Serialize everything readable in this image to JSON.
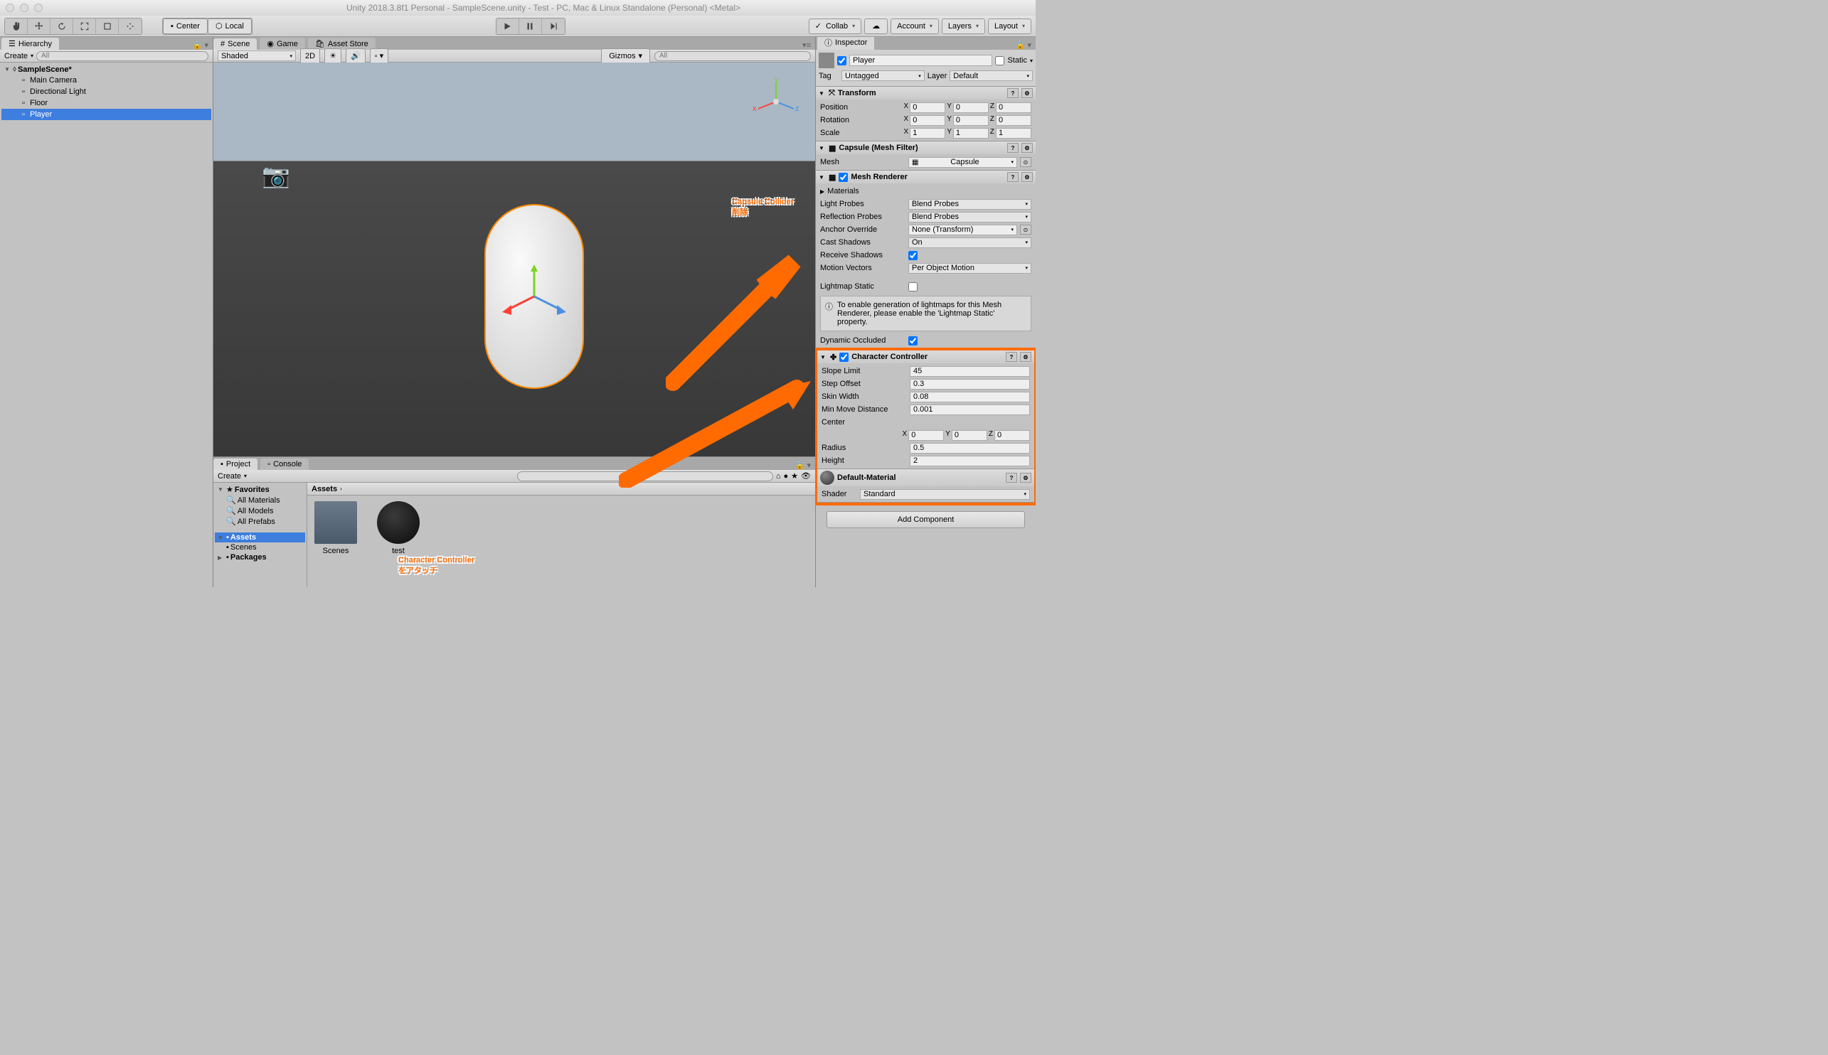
{
  "window_title": "Unity 2018.3.8f1 Personal - SampleScene.unity - Test - PC, Mac & Linux Standalone (Personal) <Metal>",
  "toolbar": {
    "center": "Center",
    "local": "Local",
    "collab": "Collab",
    "account": "Account",
    "layers": "Layers",
    "layout": "Layout"
  },
  "hierarchy": {
    "title": "Hierarchy",
    "create": "Create",
    "search_placeholder": "All",
    "scene": "SampleScene*",
    "items": [
      "Main Camera",
      "Directional Light",
      "Floor",
      "Player"
    ]
  },
  "scene": {
    "tabs": {
      "scene": "Scene",
      "game": "Game",
      "asset_store": "Asset Store"
    },
    "shading": "Shaded",
    "twod": "2D",
    "gizmos": "Gizmos",
    "search_placeholder": "All"
  },
  "project": {
    "tabs": {
      "project": "Project",
      "console": "Console"
    },
    "create": "Create",
    "favorites": "Favorites",
    "fav_items": [
      "All Materials",
      "All Models",
      "All Prefabs"
    ],
    "assets": "Assets",
    "asset_items": [
      "Scenes"
    ],
    "packages": "Packages",
    "breadcrumb": "Assets",
    "content": [
      "Scenes",
      "test"
    ]
  },
  "inspector": {
    "title": "Inspector",
    "name": "Player",
    "static": "Static",
    "tag_label": "Tag",
    "tag_value": "Untagged",
    "layer_label": "Layer",
    "layer_value": "Default",
    "transform": {
      "title": "Transform",
      "position": "Position",
      "rotation": "Rotation",
      "scale": "Scale",
      "pos": {
        "x": "0",
        "y": "0",
        "z": "0"
      },
      "rot": {
        "x": "0",
        "y": "0",
        "z": "0"
      },
      "scl": {
        "x": "1",
        "y": "1",
        "z": "1"
      }
    },
    "mesh_filter": {
      "title": "Capsule (Mesh Filter)",
      "mesh_label": "Mesh",
      "mesh_value": "Capsule"
    },
    "mesh_renderer": {
      "title": "Mesh Renderer",
      "materials": "Materials",
      "light_probes_label": "Light Probes",
      "light_probes": "Blend Probes",
      "reflection_probes_label": "Reflection Probes",
      "reflection_probes": "Blend Probes",
      "anchor_override_label": "Anchor Override",
      "anchor_override": "None (Transform)",
      "cast_shadows_label": "Cast Shadows",
      "cast_shadows": "On",
      "receive_shadows_label": "Receive Shadows",
      "motion_vectors_label": "Motion Vectors",
      "motion_vectors": "Per Object Motion",
      "lightmap_static_label": "Lightmap Static",
      "help_text": "To enable generation of lightmaps for this Mesh Renderer, please enable the 'Lightmap Static' property.",
      "dynamic_occluded_label": "Dynamic Occluded"
    },
    "character_controller": {
      "title": "Character Controller",
      "slope_limit_label": "Slope Limit",
      "slope_limit": "45",
      "step_offset_label": "Step Offset",
      "step_offset": "0.3",
      "skin_width_label": "Skin Width",
      "skin_width": "0.08",
      "min_move_label": "Min Move Distance",
      "min_move": "0.001",
      "center_label": "Center",
      "center": {
        "x": "0",
        "y": "0",
        "z": "0"
      },
      "radius_label": "Radius",
      "radius": "0.5",
      "height_label": "Height",
      "height": "2"
    },
    "material": {
      "name": "Default-Material",
      "shader_label": "Shader",
      "shader": "Standard"
    },
    "add_component": "Add Component"
  },
  "annotations": {
    "anno1_line1": "Capsule Collider",
    "anno1_line2": "削除",
    "anno2_line1": "Character Controller",
    "anno2_line2": "をアタッチ"
  }
}
